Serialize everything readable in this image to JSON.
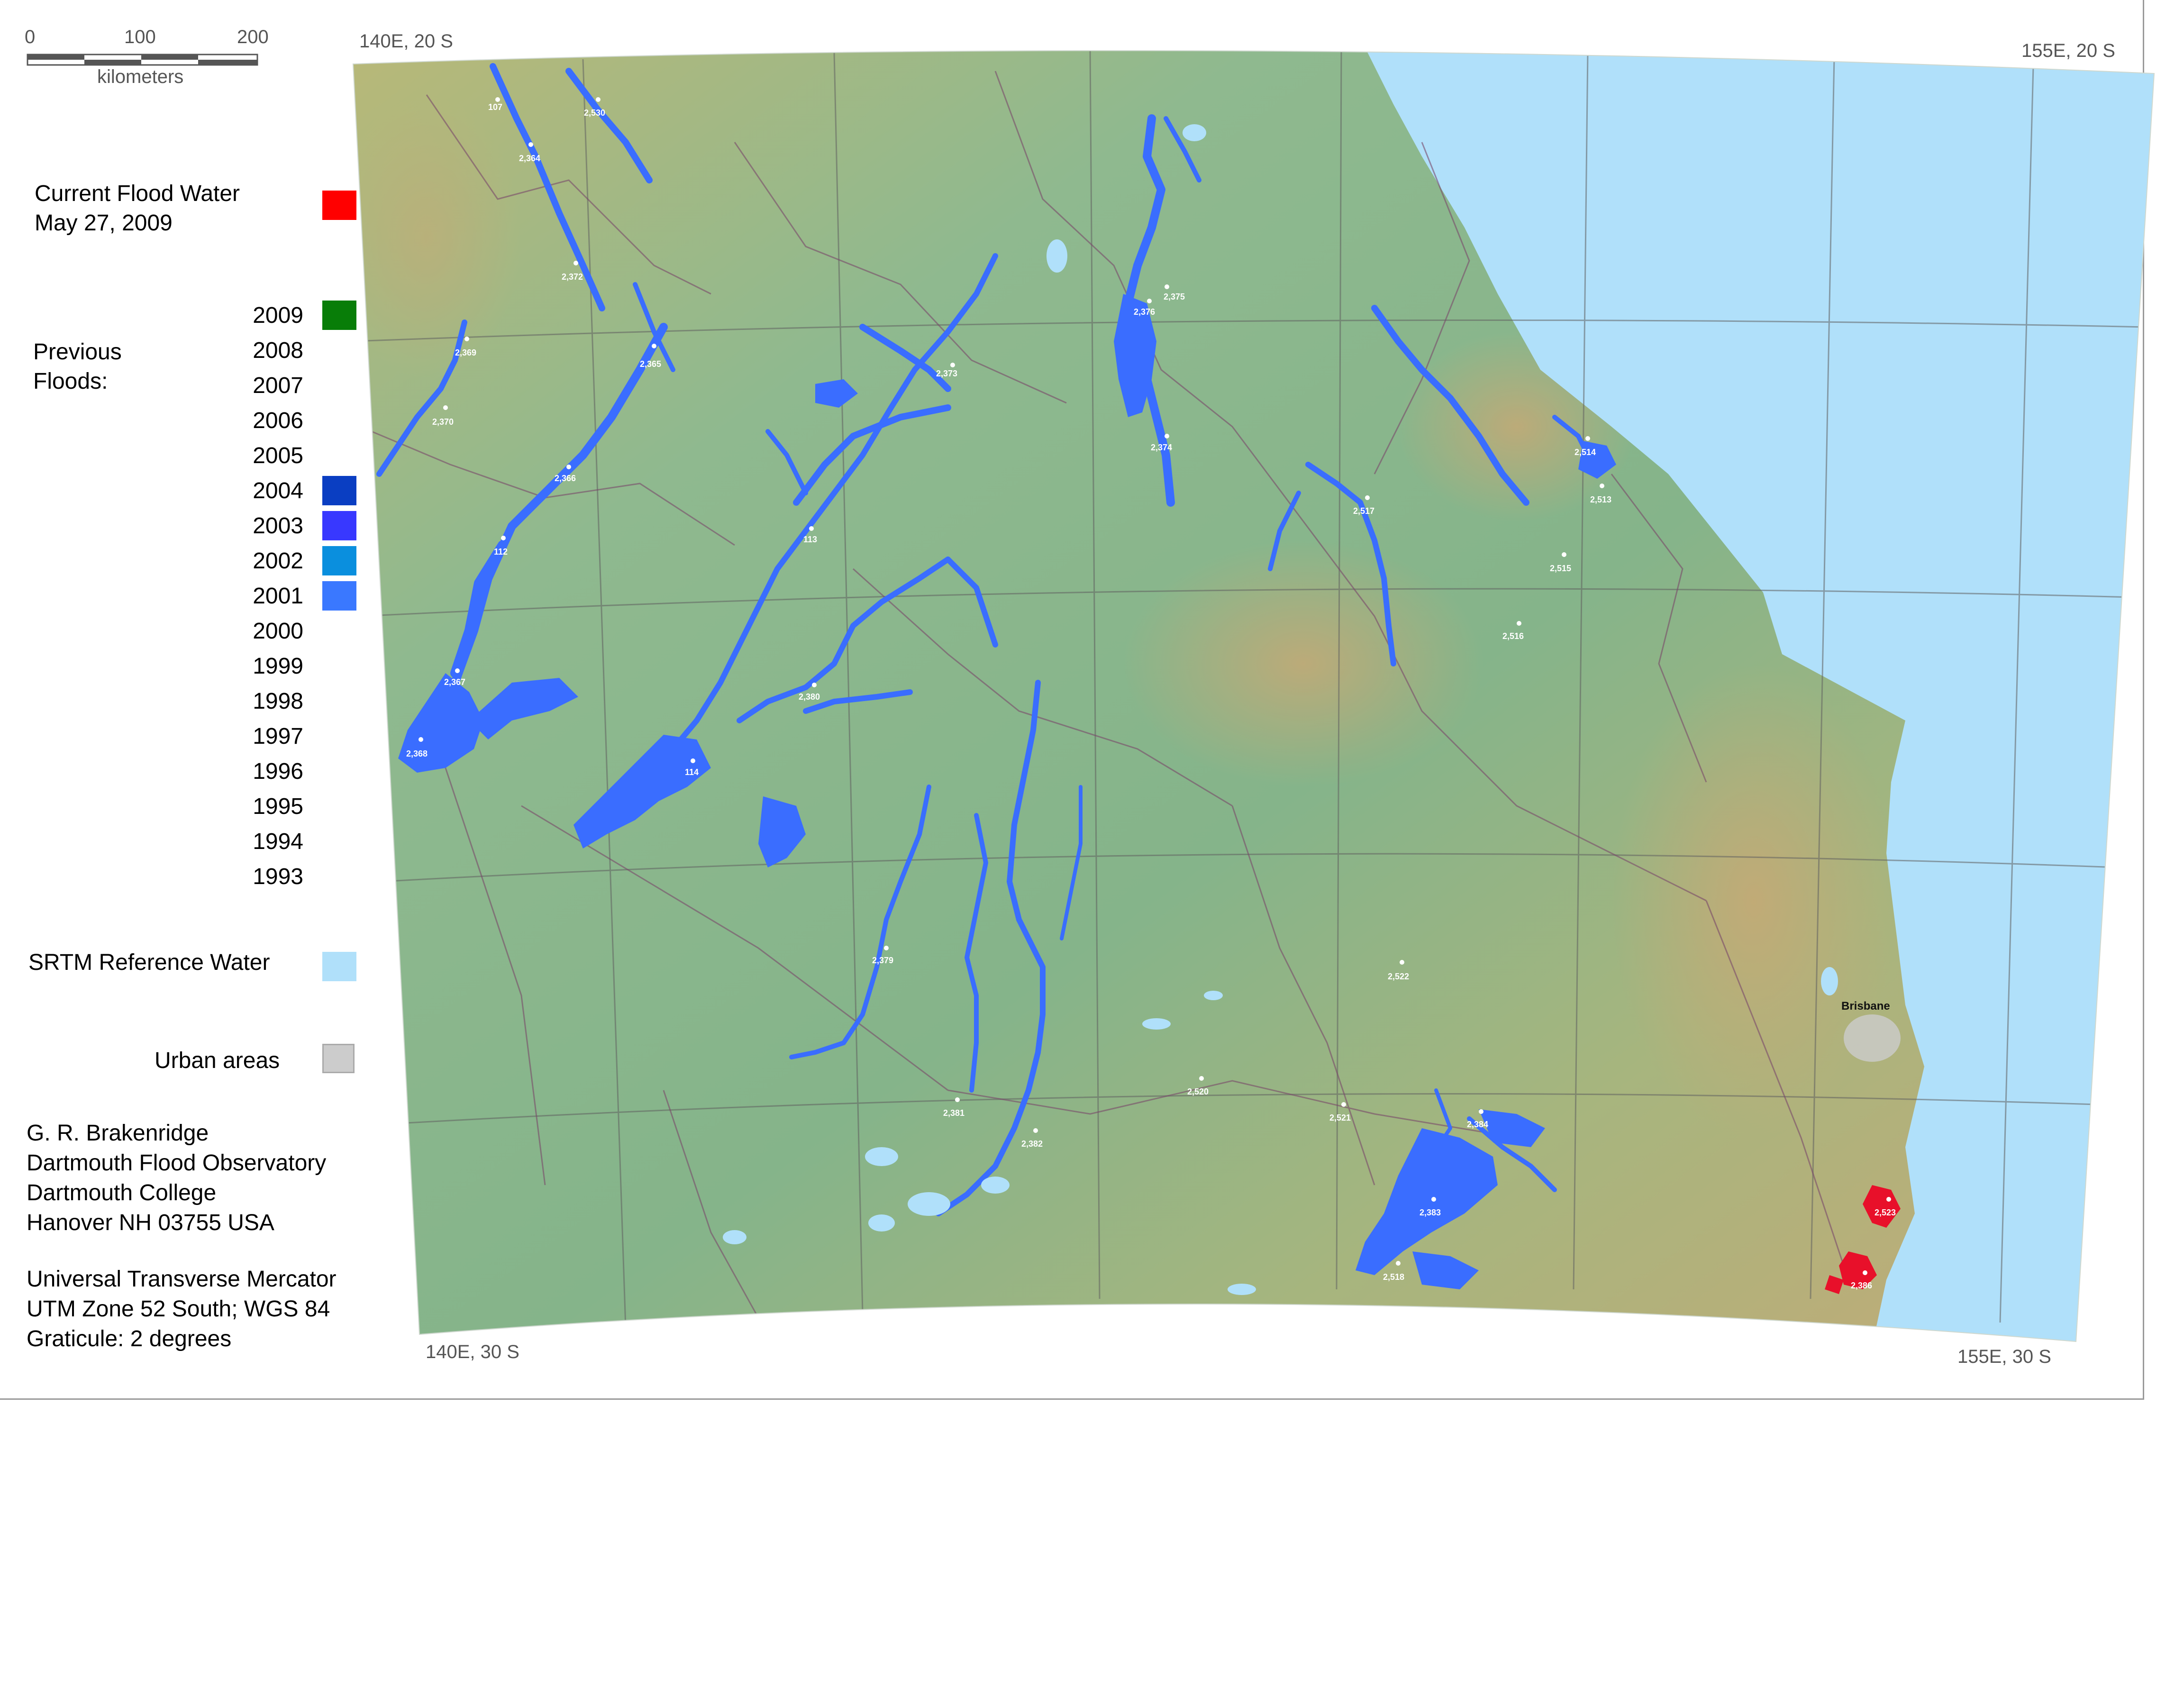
{
  "scale": {
    "ticks": [
      "0",
      "100",
      "200"
    ],
    "unit": "kilometers"
  },
  "corners": {
    "nw": "140E, 20 S",
    "ne": "155E, 20 S",
    "sw": "140E, 30 S",
    "se": "155E, 30 S"
  },
  "legend": {
    "current_flood": {
      "line1": "Current Flood Water",
      "line2": "May 27, 2009",
      "color": "#ff0000"
    },
    "previous_floods_label_1": "Previous",
    "previous_floods_label_2": "Floods:",
    "years": [
      {
        "year": "2009",
        "color": "#087d08"
      },
      {
        "year": "2008",
        "color": null
      },
      {
        "year": "2007",
        "color": null
      },
      {
        "year": "2006",
        "color": null
      },
      {
        "year": "2005",
        "color": null
      },
      {
        "year": "2004",
        "color": "#0a3ec2"
      },
      {
        "year": "2003",
        "color": "#3838ff"
      },
      {
        "year": "2002",
        "color": "#0a8fde"
      },
      {
        "year": "2001",
        "color": "#3a78ff"
      },
      {
        "year": "2000",
        "color": null
      },
      {
        "year": "1999",
        "color": null
      },
      {
        "year": "1998",
        "color": null
      },
      {
        "year": "1997",
        "color": null
      },
      {
        "year": "1996",
        "color": null
      },
      {
        "year": "1995",
        "color": null
      },
      {
        "year": "1994",
        "color": null
      },
      {
        "year": "1993",
        "color": null
      }
    ],
    "srtm": {
      "label": "SRTM Reference Water",
      "color": "#b0e0fa"
    },
    "urban": {
      "label": "Urban areas",
      "color": "#cccccc"
    }
  },
  "credits": [
    "G. R. Brakenridge",
    "Dartmouth Flood Observatory",
    "Dartmouth College",
    "Hanover NH 03755 USA"
  ],
  "projection": [
    "Universal Transverse Mercator",
    "UTM Zone 52 South; WGS 84",
    "Graticule:  2 degrees"
  ],
  "city": "Brisbane",
  "gauges": [
    "107",
    "2,530",
    "2,364",
    "2,372",
    "2,369",
    "2,365",
    "2,370",
    "2,366",
    "112",
    "2,367",
    "2,368",
    "114",
    "2,373",
    "113",
    "2,380",
    "2,376",
    "2,375",
    "2,374",
    "2,517",
    "2,514",
    "2,513",
    "2,515",
    "2,516",
    "2,379",
    "2,381",
    "2,382",
    "2,520",
    "2,521",
    "2,384",
    "2,522",
    "2,383",
    "2,518",
    "2,523",
    "2,386"
  ],
  "colors": {
    "ocean": "#b0e0fa",
    "land_low": "#8fb98f",
    "land_high": "#c9b27a",
    "flood_blue": "#3a6dff",
    "current_red": "#e8102a",
    "border_line": "#7a4a6a"
  }
}
